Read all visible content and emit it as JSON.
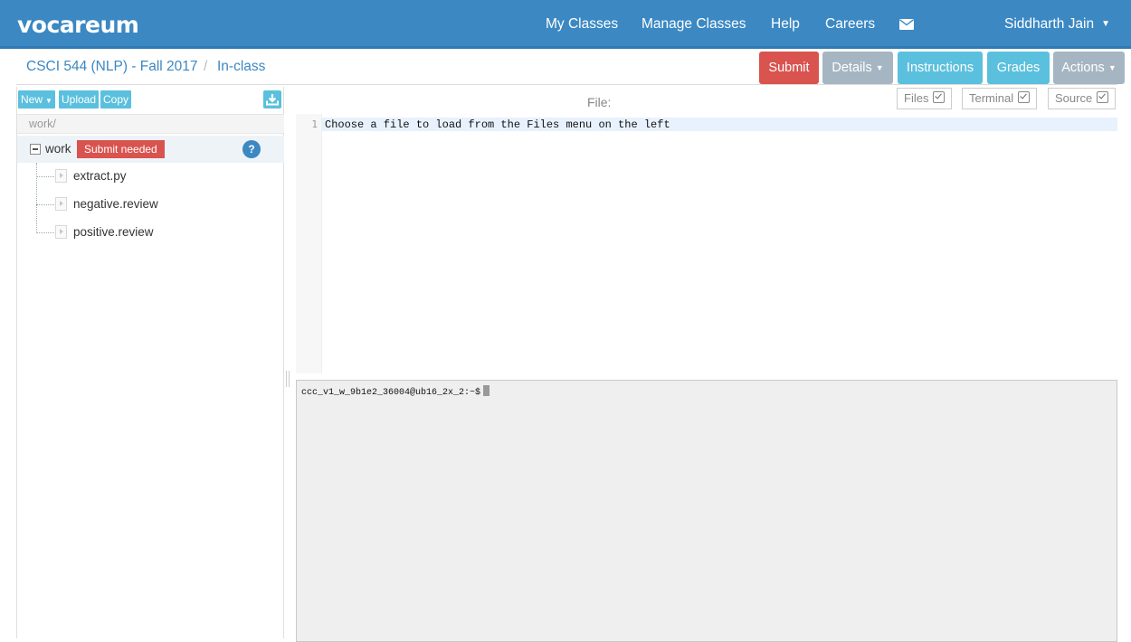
{
  "navbar": {
    "logo": "vocareum",
    "links": {
      "my_classes": "My Classes",
      "manage_classes": "Manage Classes",
      "help": "Help",
      "careers": "Careers"
    },
    "mail_icon": "envelope-icon",
    "user_name": "Siddharth Jain",
    "bg_color": "#3b88c3"
  },
  "breadcrumb": {
    "course": "CSCI 544 (NLP) - Fall 2017",
    "separator": "/",
    "assignment": "In-class"
  },
  "actions": {
    "submit": "Submit",
    "details": "Details",
    "instructions": "Instructions",
    "grades": "Grades",
    "actions": "Actions"
  },
  "file_panel": {
    "toolbar": {
      "new": "New",
      "upload": "Upload",
      "copy": "Copy",
      "download_icon": "download-icon"
    },
    "path": "work/",
    "root": {
      "label": "work",
      "badge": "Submit needed",
      "help": "?"
    },
    "files": [
      "extract.py",
      "negative.review",
      "positive.review"
    ]
  },
  "editor": {
    "file_label": "File:",
    "toggles": {
      "files": "Files",
      "terminal": "Terminal",
      "source": "Source"
    },
    "line_number": "1",
    "content": "Choose a file to load from the Files menu on the left"
  },
  "terminal": {
    "prompt": "ccc_v1_w_9b1e2_36004@ub16_2x_2:~$"
  }
}
